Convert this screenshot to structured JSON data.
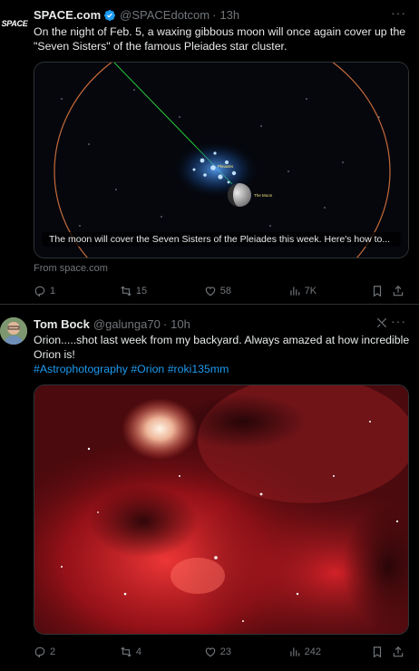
{
  "tweets": [
    {
      "avatar_text": "SPACE",
      "name": "SPACE.com",
      "handle": "@SPACEdotcom",
      "sep": "·",
      "time": "13h",
      "more": "···",
      "text": "On the night of Feb. 5, a waxing gibbous moon will once again cover up the \"Seven Sisters\" of the famous Pleiades star cluster.",
      "card": {
        "label_pleiades": "Pleiades",
        "label_moon": "The Moon",
        "caption": "The moon will cover the Seven Sisters of the Pleiades this week. Here's how to..."
      },
      "from": "From space.com",
      "replies": "1",
      "reposts": "15",
      "likes": "58",
      "views": "7K"
    },
    {
      "name": "Tom Bock",
      "handle": "@galunga70",
      "sep": "·",
      "time": "10h",
      "more": "···",
      "text": "Orion.....shot last week from my backyard.   Always amazed at how incredible Orion is!",
      "hashtags": [
        "#Astrophotography",
        "#Orion",
        "#roki135mm"
      ],
      "replies": "2",
      "reposts": "4",
      "likes": "23",
      "views": "242"
    }
  ],
  "colors": {
    "accent": "#1d9bf0",
    "muted": "#71767b",
    "verified": "#1d9bf0"
  }
}
